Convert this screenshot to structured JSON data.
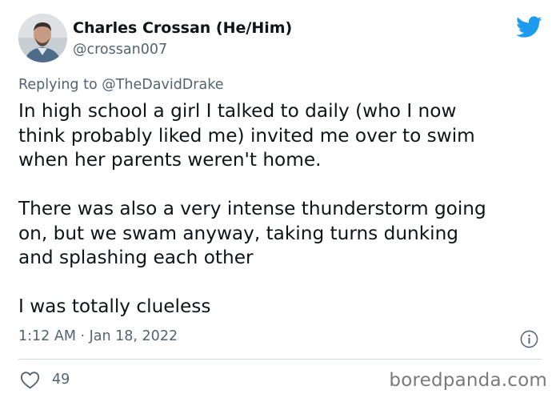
{
  "author": {
    "display_name": "Charles Crossan (He/Him)",
    "handle": "@crossan007"
  },
  "reply": {
    "prefix": "Replying to ",
    "mention": "@TheDavidDrake"
  },
  "tweet": {
    "lines": [
      "In high school a girl I talked to daily (who I now",
      "think probably liked me) invited me over to swim",
      "when her parents weren't home.",
      "",
      "There was also a very intense thunderstorm going",
      "on, but we swam anyway, taking turns dunking",
      "and splashing each other",
      "",
      "I was totally clueless"
    ]
  },
  "meta": {
    "timestamp": "1:12 AM · Jan 18, 2022"
  },
  "engagement": {
    "likes": "49"
  },
  "watermark": "boredpanda.com",
  "icons": {
    "brand": "twitter-bird-icon",
    "info": "info-icon",
    "like": "heart-icon"
  },
  "colors": {
    "twitter_blue": "#1d9bf0",
    "secondary_text": "#536471",
    "primary_text": "#0f1419"
  }
}
